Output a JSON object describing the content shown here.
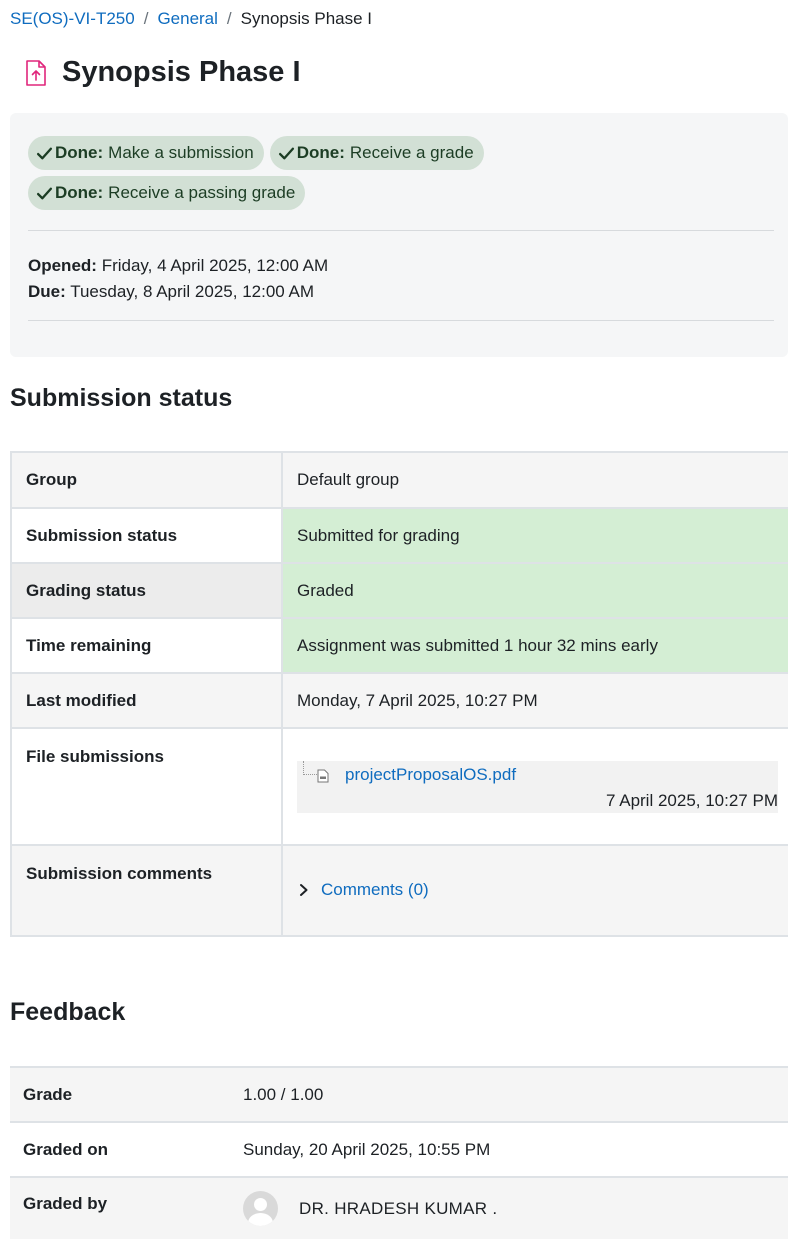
{
  "breadcrumb": {
    "course": "SE(OS)-VI-T250",
    "section": "General",
    "current": "Synopsis Phase I",
    "separator": "/"
  },
  "page": {
    "title": "Synopsis Phase I",
    "icon": "assignment-upload-icon"
  },
  "completion": [
    {
      "status": "Done:",
      "label": "Make a submission"
    },
    {
      "status": "Done:",
      "label": "Receive a grade"
    },
    {
      "status": "Done:",
      "label": "Receive a passing grade"
    }
  ],
  "dates": {
    "opened_label": "Opened:",
    "opened_value": "Friday, 4 April 2025, 12:00 AM",
    "due_label": "Due:",
    "due_value": "Tuesday, 8 April 2025, 12:00 AM"
  },
  "submission_status": {
    "heading": "Submission status",
    "rows": {
      "group": {
        "label": "Group",
        "value": "Default group"
      },
      "submission": {
        "label": "Submission status",
        "value": "Submitted for grading"
      },
      "grading": {
        "label": "Grading status",
        "value": "Graded"
      },
      "time_remaining": {
        "label": "Time remaining",
        "value": "Assignment was submitted 1 hour 32 mins early"
      },
      "last_modified": {
        "label": "Last modified",
        "value": "Monday, 7 April 2025, 10:27 PM"
      },
      "files": {
        "label": "File submissions",
        "file_name": "projectProposalOS.pdf",
        "file_date": "7 April 2025, 10:27 PM"
      },
      "comments": {
        "label": "Submission comments",
        "link": "Comments (0)"
      }
    }
  },
  "feedback": {
    "heading": "Feedback",
    "grade_label": "Grade",
    "grade_value": "1.00 / 1.00",
    "graded_on_label": "Graded on",
    "graded_on_value": "Sunday, 20 April 2025, 10:55 PM",
    "graded_by_label": "Graded by",
    "graded_by_value": "DR. HRADESH KUMAR ."
  },
  "colors": {
    "link": "#0f6cbf",
    "completion_badge_bg": "#d2e0d5",
    "success_cell_bg": "#d4eed4",
    "activity_icon": "#e0267c"
  }
}
